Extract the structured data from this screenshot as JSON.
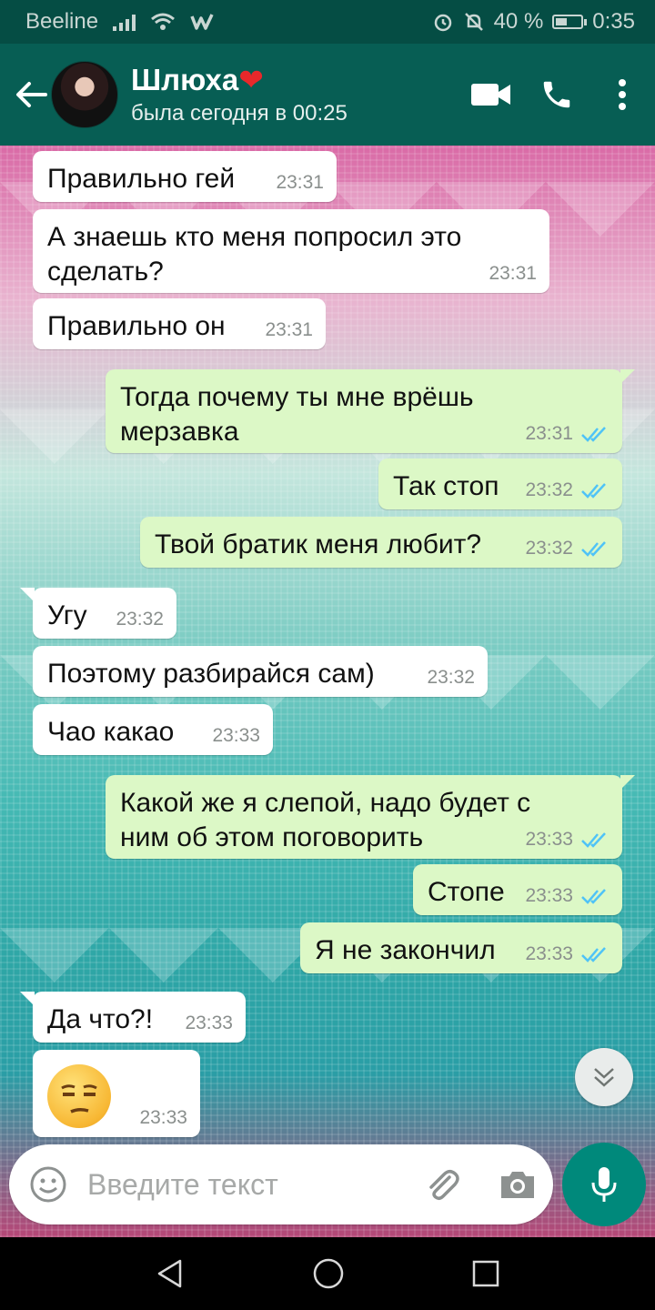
{
  "status_bar": {
    "carrier": "Beeline",
    "battery_percent": "40 %",
    "battery_level": 0.4,
    "time": "0:35"
  },
  "header": {
    "contact_name": "Шлюха",
    "last_seen": "была сегодня в 00:25"
  },
  "messages": [
    {
      "dir": "in",
      "text": "Правильно гей",
      "time": "23:31"
    },
    {
      "dir": "in",
      "text": "А знаешь кто меня попросил это сделать?",
      "time": "23:31"
    },
    {
      "dir": "in",
      "text": "Правильно он",
      "time": "23:31"
    },
    {
      "dir": "out",
      "text": "Тогда почему ты мне врёшь мерзавка",
      "time": "23:31"
    },
    {
      "dir": "out",
      "text": "Так стоп",
      "time": "23:32"
    },
    {
      "dir": "out",
      "text": "Твой братик меня любит?",
      "time": "23:32"
    },
    {
      "dir": "in",
      "text": "Угу",
      "time": "23:32"
    },
    {
      "dir": "in",
      "text": "Поэтому разбирайся сам)",
      "time": "23:32"
    },
    {
      "dir": "in",
      "text": "Чао какао",
      "time": "23:33"
    },
    {
      "dir": "out",
      "text": "Какой же я слепой, надо будет с ним об этом поговорить",
      "time": "23:33"
    },
    {
      "dir": "out",
      "text": "Стопе",
      "time": "23:33"
    },
    {
      "dir": "out",
      "text": "Я не закончил",
      "time": "23:33"
    },
    {
      "dir": "in",
      "text": "Да что?!",
      "time": "23:33"
    },
    {
      "dir": "in",
      "text": "",
      "emoji": "unamused-face-emoji",
      "time": "23:33"
    }
  ],
  "input": {
    "placeholder": "Введите текст"
  },
  "colors": {
    "header": "#075e54",
    "status_bar": "#054d44",
    "incoming_bubble": "#ffffff",
    "outgoing_bubble": "#dcf8c6",
    "read_ticks": "#4fc3f7",
    "mic_button": "#00897b"
  },
  "icons": [
    "back-arrow-icon",
    "video-call-icon",
    "phone-icon",
    "more-vert-icon",
    "emoji-icon",
    "attach-icon",
    "camera-icon",
    "mic-icon",
    "scroll-down-icon",
    "read-ticks-icon"
  ]
}
